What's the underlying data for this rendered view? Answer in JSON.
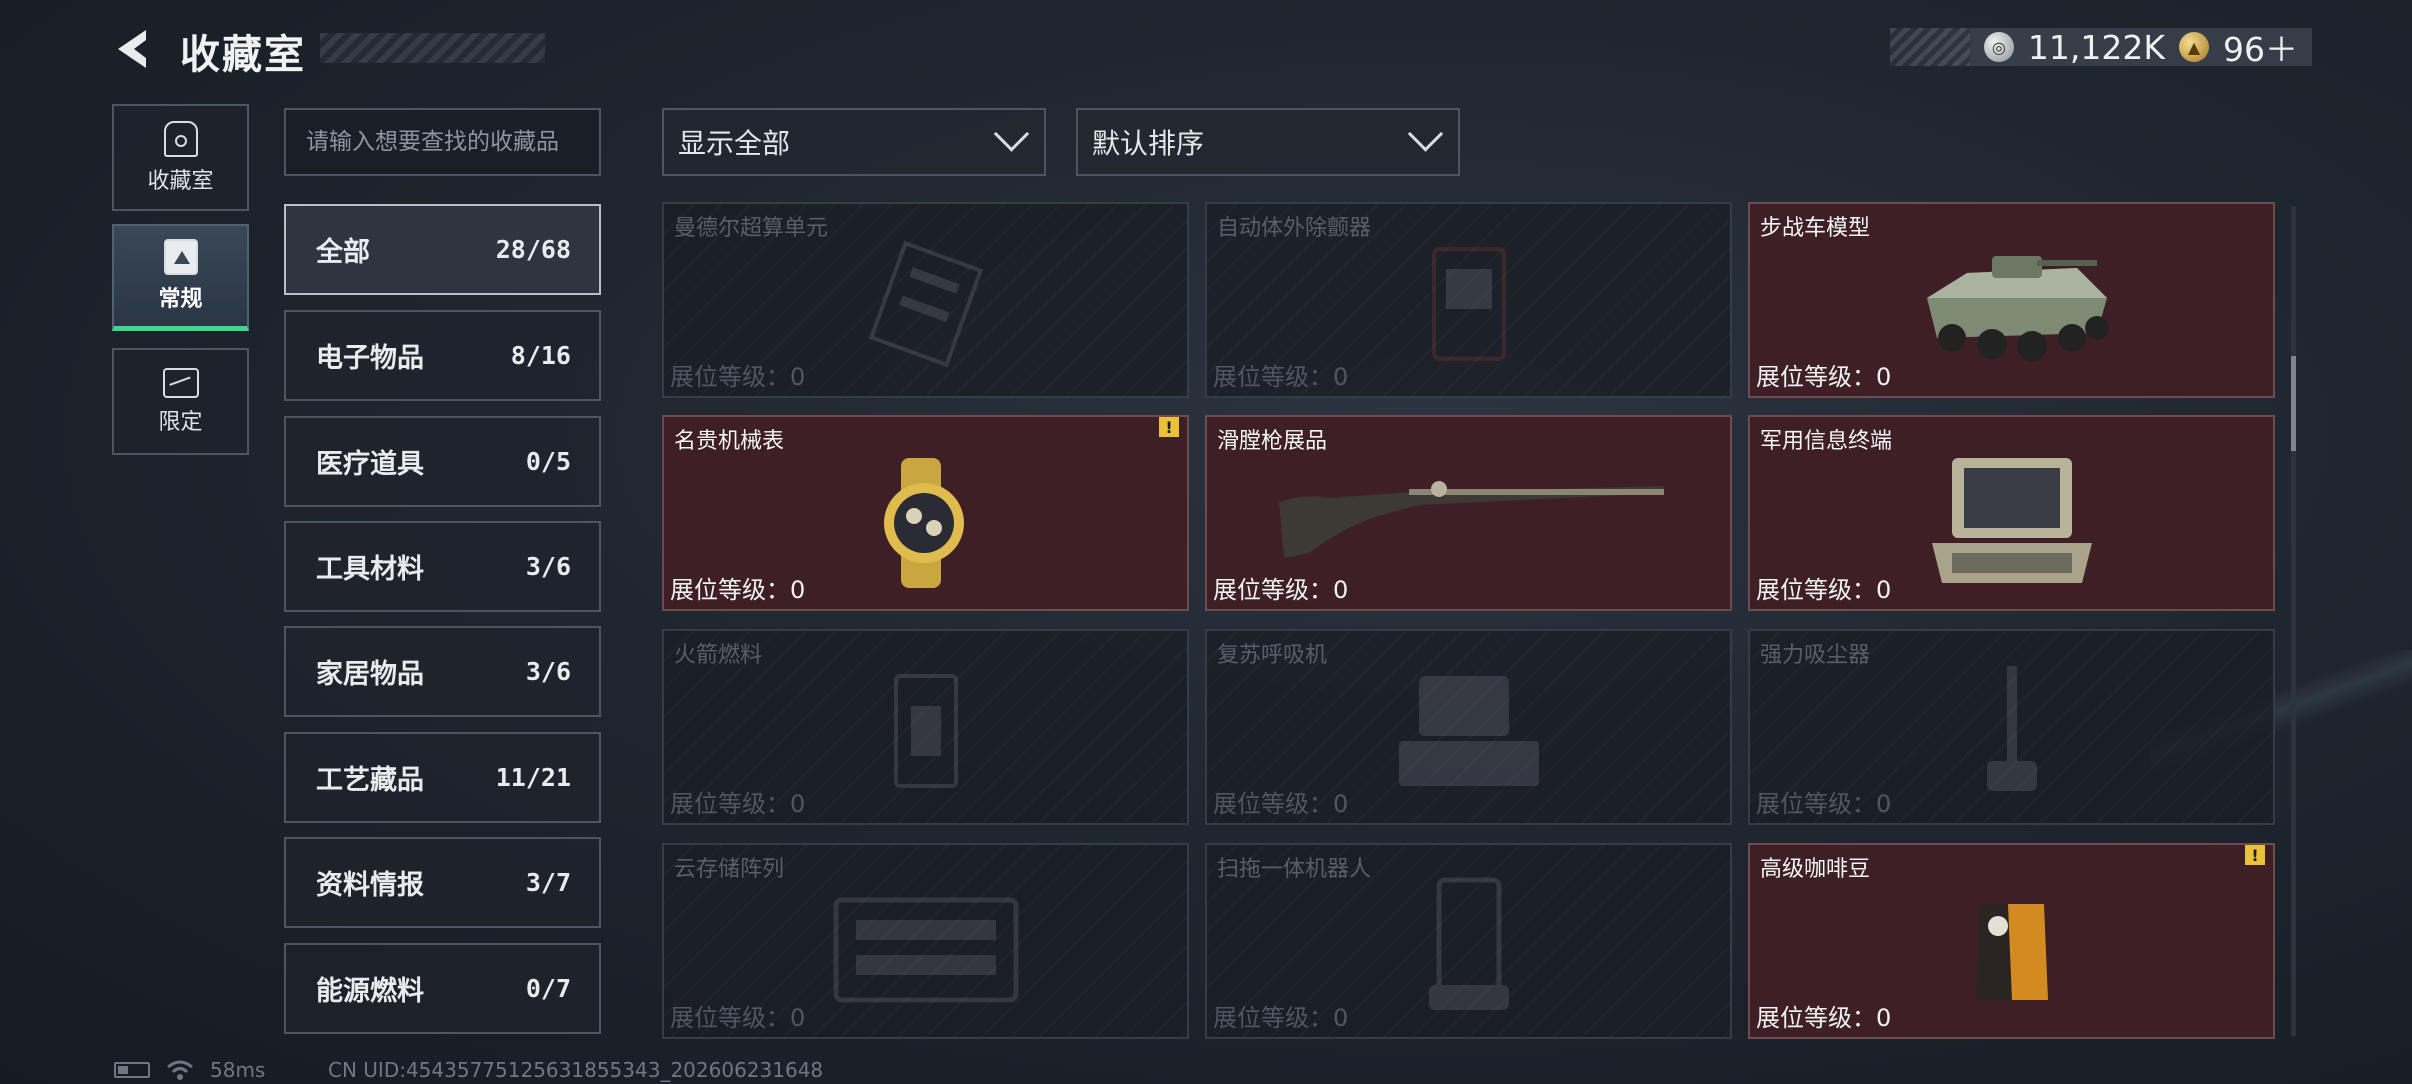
{
  "header": {
    "title": "收藏室",
    "currency": [
      {
        "icon": "silver-coin-icon",
        "value": "11,122K"
      },
      {
        "icon": "gold-coin-icon",
        "value": "96＋"
      }
    ]
  },
  "side_tabs": [
    {
      "label": "收藏室",
      "icon": "collection-room-icon",
      "active": false
    },
    {
      "label": "常规",
      "icon": "regular-document-icon",
      "active": true
    },
    {
      "label": "限定",
      "icon": "limited-map-icon",
      "active": false
    }
  ],
  "search": {
    "placeholder": "请输入想要查找的收藏品"
  },
  "categories": [
    {
      "name": "全部",
      "count": "28/68",
      "active": true
    },
    {
      "name": "电子物品",
      "count": "8/16"
    },
    {
      "name": "医疗道具",
      "count": "0/5"
    },
    {
      "name": "工具材料",
      "count": "3/6"
    },
    {
      "name": "家居物品",
      "count": "3/6"
    },
    {
      "name": "工艺藏品",
      "count": "11/21"
    },
    {
      "name": "资料情报",
      "count": "3/7"
    },
    {
      "name": "能源燃料",
      "count": "0/7"
    }
  ],
  "filters": {
    "display": "显示全部",
    "sort": "默认排序"
  },
  "items": [
    {
      "name": "曼德尔超算单元",
      "level_label": "展位等级：",
      "level": "0",
      "owned": false,
      "icon": "supercomputer-unit-icon"
    },
    {
      "name": "自动体外除颤器",
      "level_label": "展位等级：",
      "level": "0",
      "owned": false,
      "icon": "defibrillator-icon"
    },
    {
      "name": "步战车模型",
      "level_label": "展位等级：",
      "level": "0",
      "owned": true,
      "icon": "ifv-model-icon"
    },
    {
      "name": "名贵机械表",
      "level_label": "展位等级：",
      "level": "0",
      "owned": true,
      "alert": "!",
      "icon": "luxury-watch-icon"
    },
    {
      "name": "滑膛枪展品",
      "level_label": "展位等级：",
      "level": "0",
      "owned": true,
      "icon": "musket-icon"
    },
    {
      "name": "军用信息终端",
      "level_label": "展位等级：",
      "level": "0",
      "owned": true,
      "icon": "military-terminal-icon"
    },
    {
      "name": "火箭燃料",
      "level_label": "展位等级：",
      "level": "0",
      "owned": false,
      "icon": "rocket-fuel-icon"
    },
    {
      "name": "复苏呼吸机",
      "level_label": "展位等级：",
      "level": "0",
      "owned": false,
      "icon": "ventilator-icon"
    },
    {
      "name": "强力吸尘器",
      "level_label": "展位等级：",
      "level": "0",
      "owned": false,
      "icon": "vacuum-cleaner-icon"
    },
    {
      "name": "云存储阵列",
      "level_label": "展位等级：",
      "level": "0",
      "owned": false,
      "icon": "storage-array-icon"
    },
    {
      "name": "扫拖一体机器人",
      "level_label": "展位等级：",
      "level": "0",
      "owned": false,
      "icon": "robot-vacuum-icon"
    },
    {
      "name": "高级咖啡豆",
      "level_label": "展位等级：",
      "level": "0",
      "owned": true,
      "alert": "!",
      "icon": "coffee-beans-icon"
    }
  ],
  "status": {
    "ping": "58ms",
    "uid": "CN UID:45435775125631855343_202606231648"
  },
  "colors": {
    "owned_card": "#3e1f25",
    "active_tab_accent": "#3fd58c",
    "alert": "#e9c23a"
  }
}
